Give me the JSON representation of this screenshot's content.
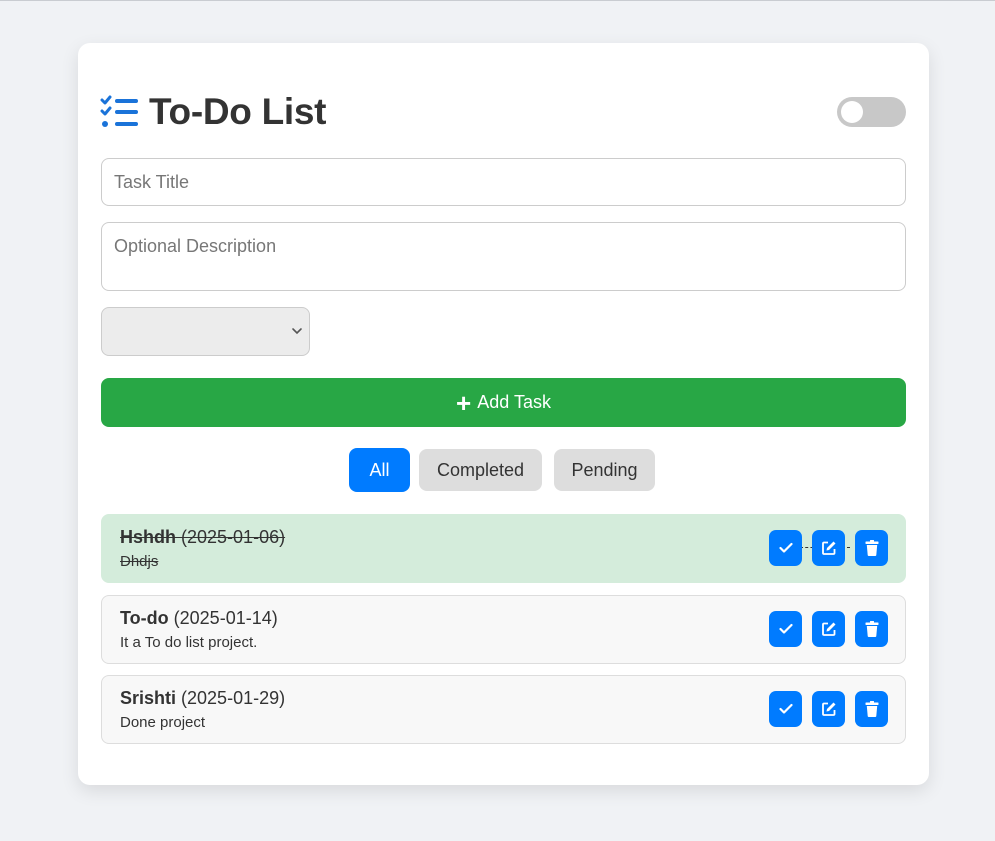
{
  "app": {
    "title": "To-Do List",
    "logo_icon": "checklist-icon",
    "accent_color": "#1a73d9",
    "theme_toggle": {
      "icon": "toggle-switch",
      "on": false
    }
  },
  "form": {
    "title_placeholder": "Task Title",
    "title_value": "",
    "description_placeholder": "Optional Description",
    "description_value": "",
    "category_select": {
      "selected": "",
      "icon": "chevron-down-icon"
    },
    "add_button_label": "Add Task",
    "add_button_icon": "plus-icon",
    "add_button_color": "#28a745"
  },
  "filters": {
    "items": [
      {
        "label": "All",
        "active": true
      },
      {
        "label": "Completed",
        "active": false
      },
      {
        "label": "Pending",
        "active": false
      }
    ],
    "active_color": "#007bff"
  },
  "tasks": [
    {
      "name": "Hshdh",
      "date": "(2025-01-06)",
      "description": "Dhdjs",
      "completed": true
    },
    {
      "name": "To-do",
      "date": "(2025-01-14)",
      "description": "It a To do list project.",
      "completed": false
    },
    {
      "name": "Srishti",
      "date": "(2025-01-29)",
      "description": "Done project",
      "completed": false
    }
  ],
  "task_actions": {
    "complete_icon": "check-icon",
    "edit_icon": "edit-icon",
    "delete_icon": "trash-icon",
    "button_color": "#007bff",
    "completed_row_color": "#d4ecdb"
  }
}
